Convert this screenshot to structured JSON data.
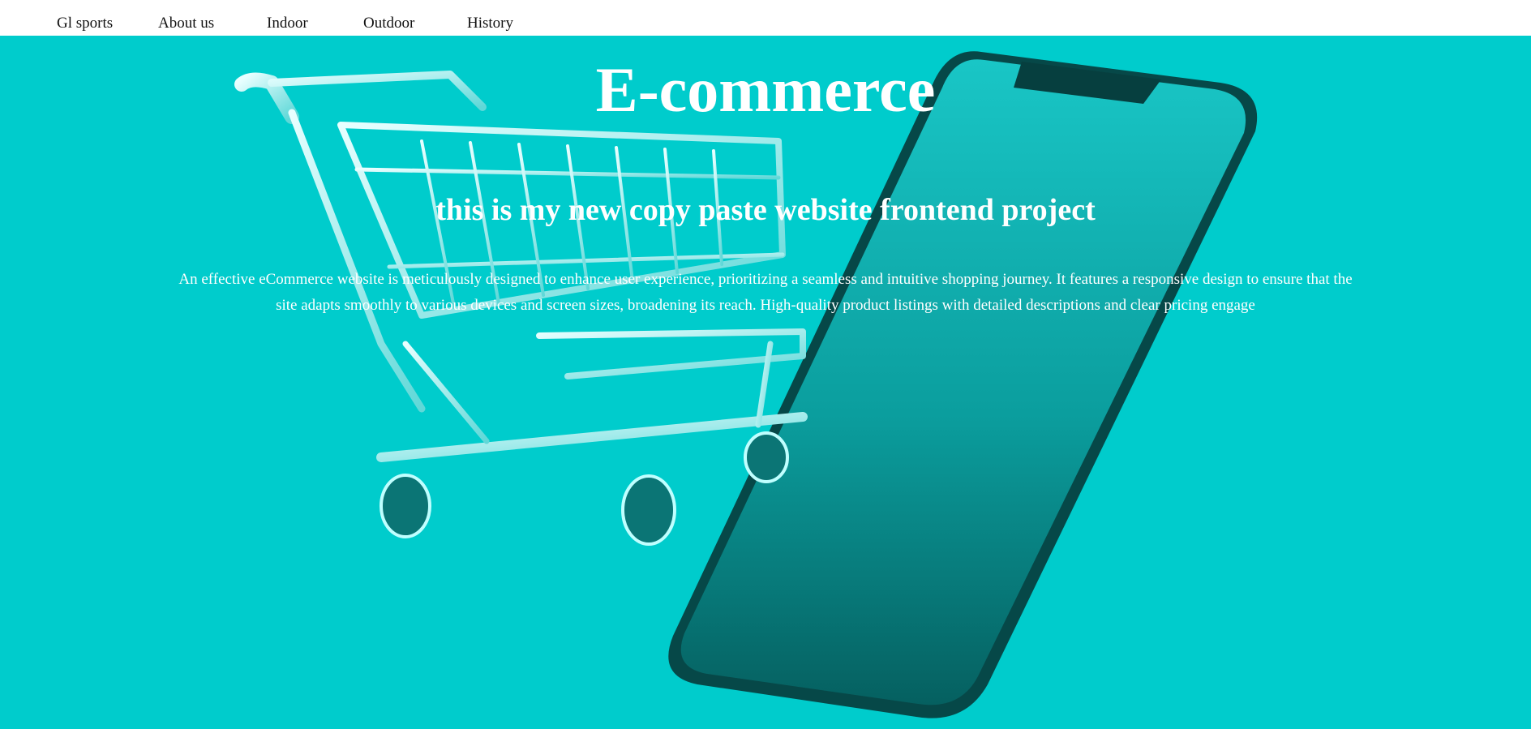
{
  "nav": {
    "items": [
      {
        "label": "Gl sports"
      },
      {
        "label": "About us"
      },
      {
        "label": "Indoor"
      },
      {
        "label": "Outdoor"
      },
      {
        "label": "History"
      }
    ]
  },
  "hero": {
    "title": "E-commerce",
    "subtitle": "this is my new copy paste website frontend project",
    "description": "An effective eCommerce website is meticulously designed to enhance user experience, prioritizing a seamless and intuitive shopping journey. It features a responsive design to ensure that the site adapts smoothly to various devices and screen sizes, broadening its reach. High-quality product listings with detailed descriptions and clear pricing engage",
    "background_color": "#00cccc",
    "image_icons": [
      "shopping-cart-icon",
      "smartphone-icon"
    ]
  }
}
